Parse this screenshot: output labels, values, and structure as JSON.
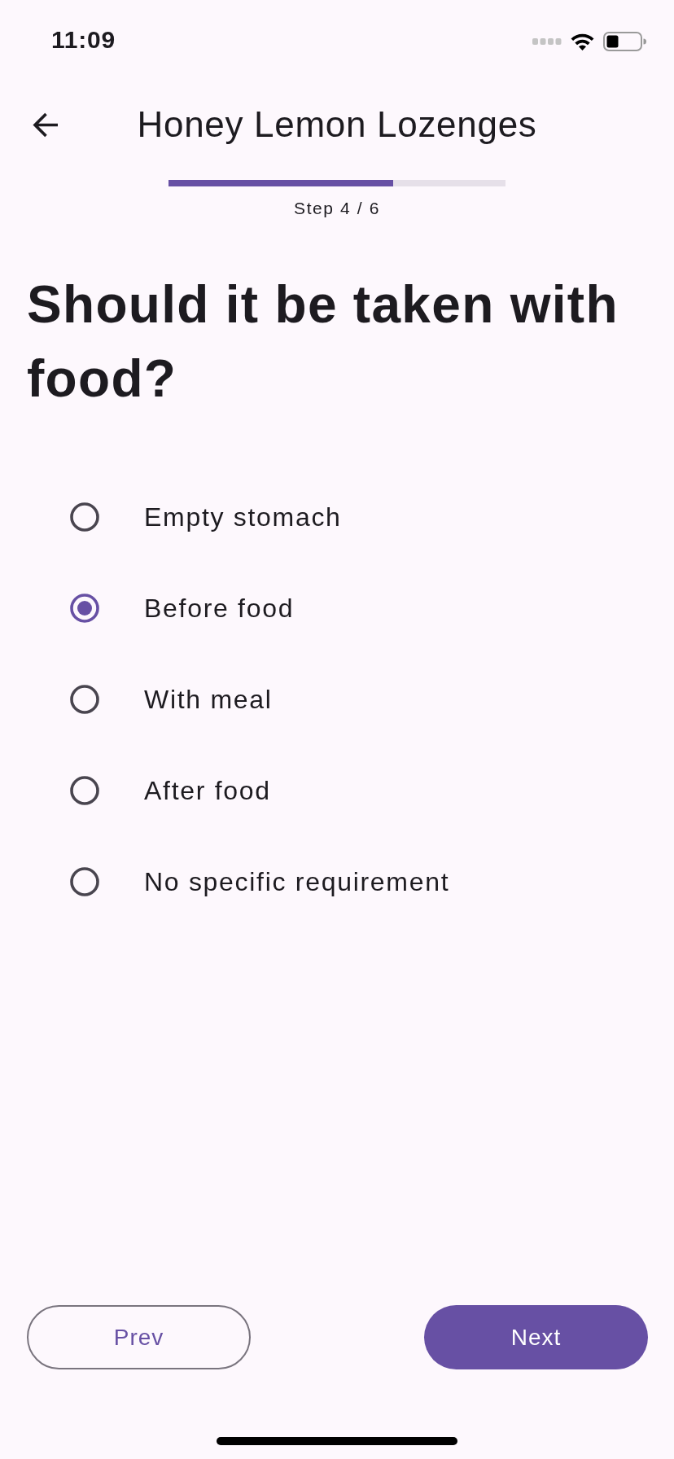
{
  "status_bar": {
    "time": "11:09"
  },
  "header": {
    "title": "Honey Lemon Lozenges"
  },
  "progress": {
    "level": 0.667,
    "label": "Step 4 / 6"
  },
  "question": "Should it be taken with food?",
  "options": [
    {
      "label": "Empty stomach",
      "selected": false
    },
    {
      "label": "Before food",
      "selected": true
    },
    {
      "label": "With meal",
      "selected": false
    },
    {
      "label": "After food",
      "selected": false
    },
    {
      "label": "No specific requirement",
      "selected": false
    }
  ],
  "buttons": [
    {
      "label": "Prev",
      "kind": "outlined"
    },
    {
      "label": "Next",
      "kind": "filled"
    }
  ]
}
